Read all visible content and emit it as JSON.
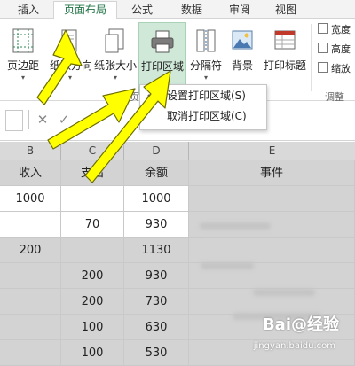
{
  "ribbon": {
    "tabs": [
      {
        "label": "插入",
        "active": false
      },
      {
        "label": "页面布局",
        "active": true
      },
      {
        "label": "公式",
        "active": false
      },
      {
        "label": "数据",
        "active": false
      },
      {
        "label": "审阅",
        "active": false
      },
      {
        "label": "视图",
        "active": false
      }
    ],
    "buttons": {
      "margins": "页边距",
      "orientation": "纸张方向",
      "size": "纸张大小",
      "print_area": "打印区域",
      "breaks": "分隔符",
      "background": "背景",
      "print_titles": "打印标题"
    },
    "group_label_page": "页",
    "group_label_adjust": "调整",
    "side_items": [
      "宽度",
      "高度",
      "缩放"
    ]
  },
  "print_area_menu": {
    "items": [
      {
        "label": "设置打印区域(S)"
      },
      {
        "label": "取消打印区域(C)"
      }
    ]
  },
  "formula_bar": {
    "cancel_symbol": "✕",
    "confirm_symbol": "✓"
  },
  "sheet": {
    "columns": [
      "B",
      "C",
      "D",
      "E"
    ],
    "headers": [
      "收入",
      "支出",
      "余额",
      "事件"
    ],
    "rows": [
      {
        "income": "1000",
        "expense": "",
        "balance": "1000",
        "shaded": false
      },
      {
        "income": "",
        "expense": "70",
        "balance": "930",
        "shaded": false
      },
      {
        "income": "200",
        "expense": "",
        "balance": "1130",
        "shaded": true
      },
      {
        "income": "",
        "expense": "200",
        "balance": "930",
        "shaded": true
      },
      {
        "income": "",
        "expense": "200",
        "balance": "730",
        "shaded": true
      },
      {
        "income": "",
        "expense": "100",
        "balance": "630",
        "shaded": true
      },
      {
        "income": "",
        "expense": "100",
        "balance": "530",
        "shaded": true
      }
    ]
  },
  "watermark": {
    "brand": "Bai@经验",
    "url": "jingyan.baidu.com"
  },
  "colors": {
    "accent": "#217346",
    "highlight": "#cfe8d8",
    "selection": "#d3d3d3",
    "arrow": "#ffff00"
  }
}
